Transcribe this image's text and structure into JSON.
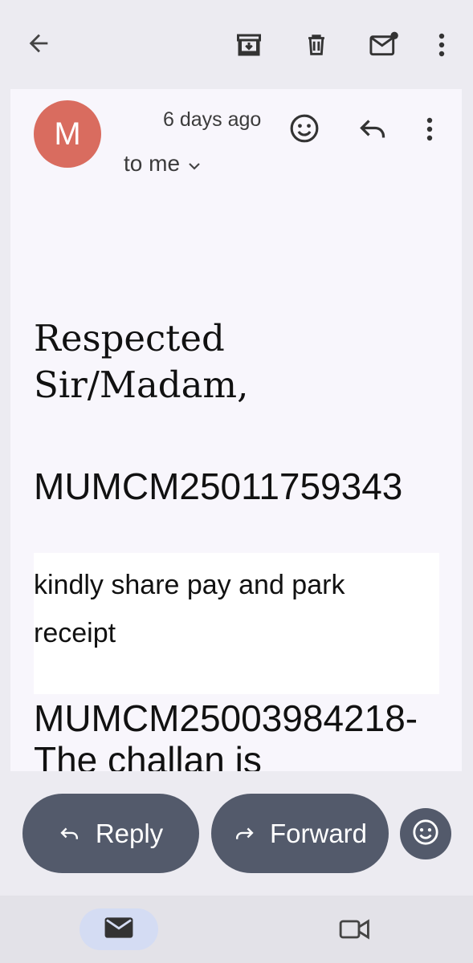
{
  "toolbar": {
    "icons": [
      "back-arrow-icon",
      "archive-icon",
      "delete-icon",
      "mark-unread-icon",
      "more-vert-icon"
    ]
  },
  "message": {
    "avatar_letter": "M",
    "time": "6 days ago",
    "recipient": "to me",
    "greeting": "Respected Sir/Madam,",
    "reference_1": "MUMCM25011759343",
    "note": "kindly share pay and park receipt",
    "reference_2": "MUMCM25003984218-The challan is"
  },
  "actions": {
    "reply_label": "Reply",
    "forward_label": "Forward"
  },
  "colors": {
    "avatar": "#d96c5f",
    "action_button": "#535a6b",
    "background": "#ecebf1",
    "sheet": "#f8f6fc",
    "nav_active": "#d4dcf3"
  }
}
